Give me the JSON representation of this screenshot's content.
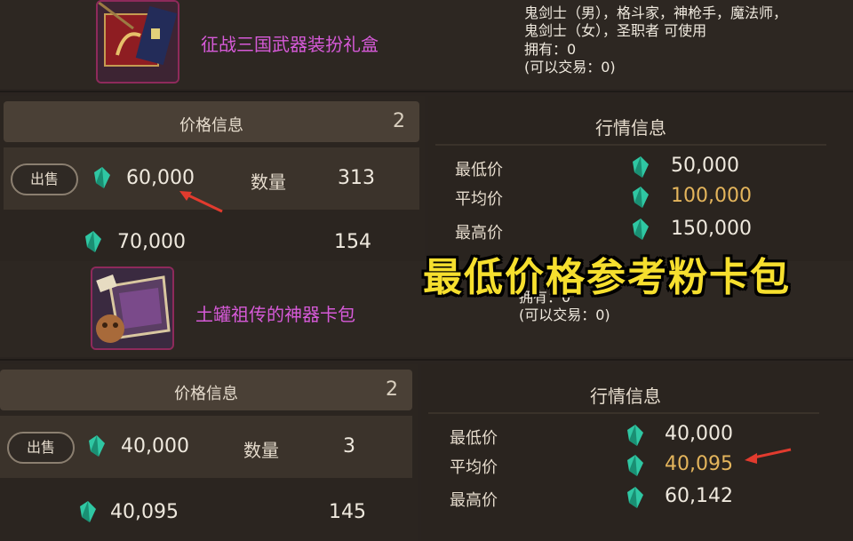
{
  "item1": {
    "name": "征战三国武器装扮礼盒",
    "desc_line1": "鬼剑士（男），格斗家，神枪手，魔法师，",
    "desc_line2": "鬼剑士（女），圣职者 可使用",
    "owned": "拥有：0",
    "tradable": "(可以交易：0)",
    "price_header": "价格信息",
    "price_count": "2",
    "sell_label": "出售",
    "sell_price": "60,000",
    "qty_label": "数量",
    "qty_value": "313",
    "second_price": "70,000",
    "second_qty": "154",
    "market_header": "行情信息",
    "min_label": "最低价",
    "min_value": "50,000",
    "avg_label": "平均价",
    "avg_value": "100,000",
    "max_label": "最高价",
    "max_value": "150,000"
  },
  "item2": {
    "name": "土罐祖传的神器卡包",
    "owned": "拥有：0",
    "tradable": "(可以交易：0)",
    "price_header": "价格信息",
    "price_count": "2",
    "sell_label": "出售",
    "sell_price": "40,000",
    "qty_label": "数量",
    "qty_value": "3",
    "second_price": "40,095",
    "second_qty": "145",
    "market_header": "行情信息",
    "min_label": "最低价",
    "min_value": "40,000",
    "avg_label": "平均价",
    "avg_value": "40,095",
    "max_label": "最高价",
    "max_value": "60,142"
  },
  "overlay": "最低价格参考粉卡包",
  "colors": {
    "accent_pink": "#d65ad8",
    "avg_gold": "#e4b55c",
    "overlay_yellow": "#f6df2e",
    "gem_teal": "#2fc7a3",
    "arrow_red": "#e23b2e"
  }
}
